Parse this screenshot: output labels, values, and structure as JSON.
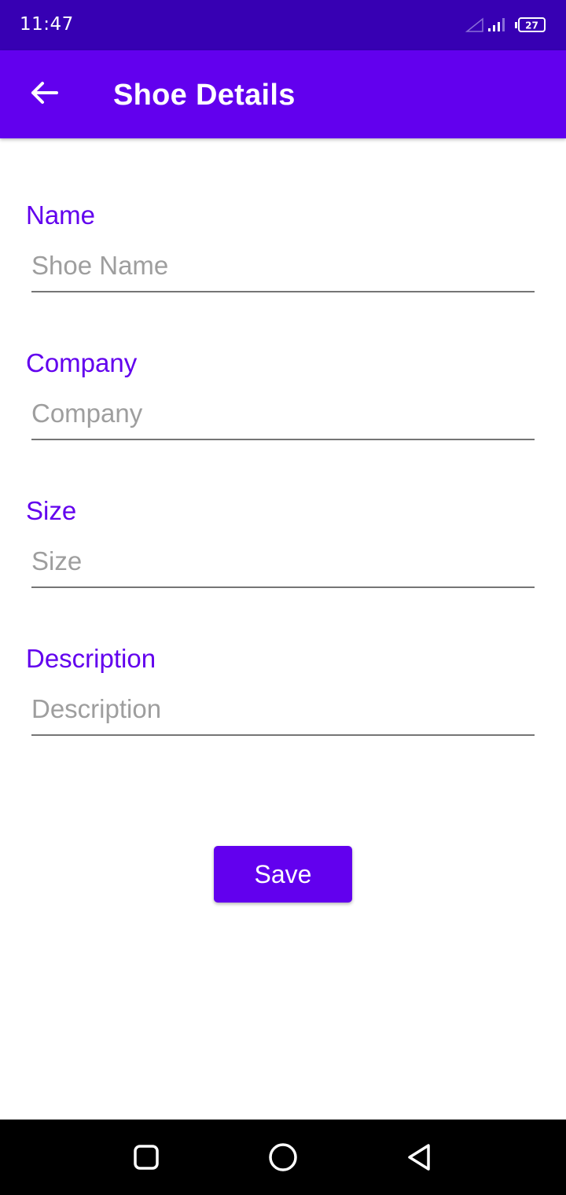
{
  "status_bar": {
    "time": "11:47",
    "battery_level": "27",
    "icons": [
      "wifi-signal-icon",
      "cellular-signal-icon",
      "battery-icon"
    ]
  },
  "app_bar": {
    "title": "Shoe Details",
    "back_icon": "arrow-back-icon",
    "background_color": "#6200ee"
  },
  "form": {
    "fields": [
      {
        "label": "Name",
        "placeholder": "Shoe Name",
        "value": ""
      },
      {
        "label": "Company",
        "placeholder": "Company",
        "value": ""
      },
      {
        "label": "Size",
        "placeholder": "Size",
        "value": ""
      },
      {
        "label": "Description",
        "placeholder": "Description",
        "value": ""
      }
    ],
    "save_label": "Save",
    "accent_color": "#6200ee"
  },
  "nav_bar": {
    "buttons": [
      "recents-square-icon",
      "home-circle-icon",
      "back-triangle-icon"
    ]
  }
}
